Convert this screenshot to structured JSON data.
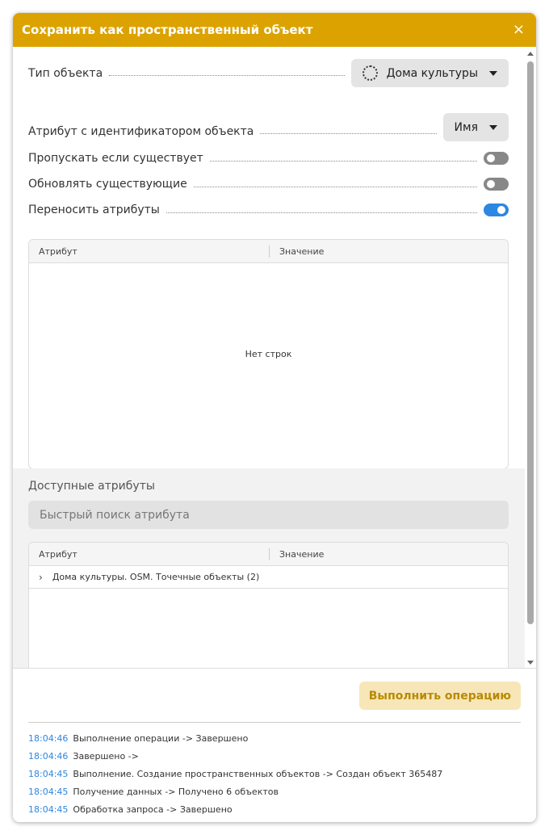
{
  "dialog": {
    "title": "Сохранить как пространственный объект",
    "close_icon": "×"
  },
  "form": {
    "object_type": {
      "label": "Тип объекта",
      "value": "Дома культуры"
    },
    "id_attribute": {
      "label": "Атрибут с идентификатором объекта",
      "value": "Имя"
    },
    "skip_existing": {
      "label": "Пропускать если существует",
      "on": false
    },
    "update_existing": {
      "label": "Обновлять существующие",
      "on": false
    },
    "transfer_attributes": {
      "label": "Переносить атрибуты",
      "on": true
    }
  },
  "attributes_grid": {
    "columns": [
      "Атрибут",
      "Значение"
    ],
    "empty_text": "Нет строк"
  },
  "available": {
    "title": "Доступные атрибуты",
    "search_placeholder": "Быстрый поиск атрибута",
    "columns": [
      "Атрибут",
      "Значение"
    ],
    "rows": [
      {
        "label": "Дома культуры. OSM. Точечные объекты (2)"
      }
    ]
  },
  "footer": {
    "run_label": "Выполнить операцию"
  },
  "log": [
    {
      "time": "18:04:46",
      "msg": "Выполнение операции -> Завершено"
    },
    {
      "time": "18:04:46",
      "msg": "Завершено ->"
    },
    {
      "time": "18:04:45",
      "msg": "Выполнение. Создание пространственных объектов -> Создан объект 365487"
    },
    {
      "time": "18:04:45",
      "msg": "Получение данных -> Получено 6 объектов"
    },
    {
      "time": "18:04:45",
      "msg": "Обработка запроса -> Завершено"
    }
  ],
  "colors": {
    "header": "#dca300",
    "toggle_on": "#2d86e2",
    "toggle_off": "#888888",
    "log_time": "#2d86e2"
  }
}
